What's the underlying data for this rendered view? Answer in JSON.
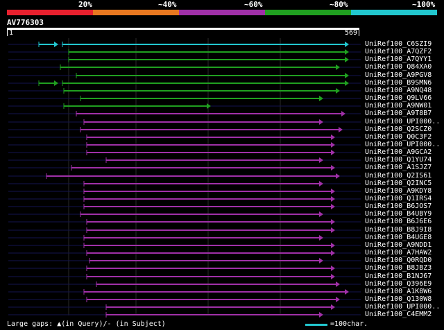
{
  "legend": {
    "labels": [
      "20%",
      "~40%",
      "~60%",
      "~80%",
      "~100%"
    ],
    "colors": [
      "#e8202e",
      "#e87820",
      "#a030a8",
      "#20a020",
      "#22c7cf"
    ]
  },
  "query": {
    "id": "AV776303",
    "start": "1",
    "end": "569"
  },
  "hits": [
    {
      "name": "UniRef100_C6SZI9",
      "color": "#22c7cf",
      "start": 90,
      "end": 503,
      "pre_segment": [
        56,
        84
      ]
    },
    {
      "name": "UniRef100_A7QZF2",
      "color": "#20a020",
      "start": 99,
      "end": 503
    },
    {
      "name": "UniRef100_A7QYY1",
      "color": "#20a020",
      "start": 99,
      "end": 503
    },
    {
      "name": "UniRef100_Q84XA0",
      "color": "#20a020",
      "start": 87,
      "end": 490
    },
    {
      "name": "UniRef100_A9PGV8",
      "color": "#20a020",
      "start": 110,
      "end": 503
    },
    {
      "name": "UniRef100_B9SMN6",
      "color": "#20a020",
      "start": 90,
      "end": 503,
      "pre_segment": [
        56,
        84
      ]
    },
    {
      "name": "UniRef100_A9NQ48",
      "color": "#20a020",
      "start": 92,
      "end": 490
    },
    {
      "name": "UniRef100_Q9LV66",
      "color": "#20a020",
      "start": 116,
      "end": 466
    },
    {
      "name": "UniRef100_A9NW01",
      "color": "#20a020",
      "start": 92,
      "end": 304
    },
    {
      "name": "UniRef100_A9T8B7",
      "color": "#a030a8",
      "start": 110,
      "end": 498
    },
    {
      "name": "UniRef100_UPI000..",
      "color": "#a030a8",
      "start": 121,
      "end": 466
    },
    {
      "name": "UniRef100_Q2SCZ0",
      "color": "#a030a8",
      "start": 116,
      "end": 494
    },
    {
      "name": "UniRef100_Q0C3F2",
      "color": "#a030a8",
      "start": 125,
      "end": 483
    },
    {
      "name": "UniRef100_UPI000..",
      "color": "#a030a8",
      "start": 125,
      "end": 483
    },
    {
      "name": "UniRef100_A9GCA2",
      "color": "#a030a8",
      "start": 125,
      "end": 483
    },
    {
      "name": "UniRef100_Q1YU74",
      "color": "#a030a8",
      "start": 153,
      "end": 466
    },
    {
      "name": "UniRef100_A1SJZ7",
      "color": "#a030a8",
      "start": 103,
      "end": 483
    },
    {
      "name": "UniRef100_Q2IS61",
      "color": "#a030a8",
      "start": 67,
      "end": 490
    },
    {
      "name": "UniRef100_Q2INC5",
      "color": "#a030a8",
      "start": 121,
      "end": 466
    },
    {
      "name": "UniRef100_A9KDY8",
      "color": "#a030a8",
      "start": 121,
      "end": 483
    },
    {
      "name": "UniRef100_Q1IRS4",
      "color": "#a030a8",
      "start": 121,
      "end": 483
    },
    {
      "name": "UniRef100_B6JOS7",
      "color": "#a030a8",
      "start": 121,
      "end": 483
    },
    {
      "name": "UniRef100_B4UBY9",
      "color": "#a030a8",
      "start": 116,
      "end": 466
    },
    {
      "name": "UniRef100_B6J6E6",
      "color": "#a030a8",
      "start": 125,
      "end": 483
    },
    {
      "name": "UniRef100_B8J9I8",
      "color": "#a030a8",
      "start": 125,
      "end": 483
    },
    {
      "name": "UniRef100_B4UGE8",
      "color": "#a030a8",
      "start": 121,
      "end": 466
    },
    {
      "name": "UniRef100_A9NDD1",
      "color": "#a030a8",
      "start": 121,
      "end": 483
    },
    {
      "name": "UniRef100_A7HAW2",
      "color": "#a030a8",
      "start": 125,
      "end": 483
    },
    {
      "name": "UniRef100_Q0RQD0",
      "color": "#a030a8",
      "start": 129,
      "end": 466
    },
    {
      "name": "UniRef100_B8JBZ3",
      "color": "#a030a8",
      "start": 125,
      "end": 483
    },
    {
      "name": "UniRef100_B1NJ67",
      "color": "#a030a8",
      "start": 125,
      "end": 483
    },
    {
      "name": "UniRef100_Q396E9",
      "color": "#a030a8",
      "start": 139,
      "end": 490
    },
    {
      "name": "UniRef100_A1K8W6",
      "color": "#a030a8",
      "start": 121,
      "end": 503
    },
    {
      "name": "UniRef100_Q130W8",
      "color": "#a030a8",
      "start": 125,
      "end": 490
    },
    {
      "name": "UniRef100_UPI000..",
      "color": "#a030a8",
      "start": 153,
      "end": 483
    },
    {
      "name": "UniRef100_C4EMM2",
      "color": "#a030a8",
      "start": 153,
      "end": 466
    }
  ],
  "footer": {
    "gaps_text": "Large gaps: ▲(in Query)/- (in Subject)",
    "scale_text": "=100char."
  }
}
